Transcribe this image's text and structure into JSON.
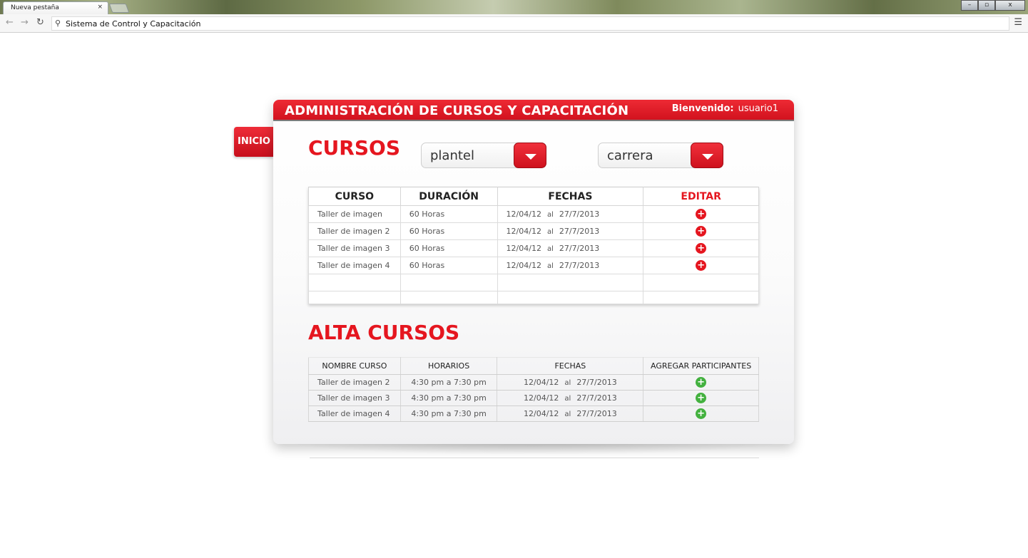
{
  "browser": {
    "tab_title": "Nueva pestaña",
    "tab_close": "×",
    "address": "Sistema de Control y Capacitación",
    "window_controls": [
      "–",
      "▫",
      "x"
    ]
  },
  "sidebar": {
    "inicio_label": "INICIO"
  },
  "header": {
    "title": "ADMINISTRACIÓN DE CURSOS Y CAPACITACIÓN",
    "welcome_label": "Bienvenido:",
    "username": "usuario1"
  },
  "cursos": {
    "title": "CURSOS",
    "filters": {
      "plantel": "plantel",
      "carrera": "carrera"
    },
    "columns": {
      "curso": "CURSO",
      "duracion": "DURACIÓN",
      "fechas": "FECHAS",
      "editar": "EDITAR"
    },
    "rows": [
      {
        "curso": "Taller de imagen",
        "duracion": "60 Horas",
        "desde": "12/04/12",
        "al": "al",
        "hasta": "27/7/2013"
      },
      {
        "curso": "Taller de imagen 2",
        "duracion": "60 Horas",
        "desde": "12/04/12",
        "al": "al",
        "hasta": "27/7/2013"
      },
      {
        "curso": "Taller de imagen 3",
        "duracion": "60 Horas",
        "desde": "12/04/12",
        "al": "al",
        "hasta": "27/7/2013"
      },
      {
        "curso": "Taller de imagen 4",
        "duracion": "60 Horas",
        "desde": "12/04/12",
        "al": "al",
        "hasta": "27/7/2013"
      }
    ]
  },
  "alta": {
    "title": "ALTA CURSOS",
    "columns": {
      "nombre": "NOMBRE CURSO",
      "horarios": "HORARIOS",
      "fechas": "FECHAS",
      "agregar": "AGREGAR PARTICIPANTES"
    },
    "rows": [
      {
        "nombre": "Taller de imagen 2",
        "horario": "4:30 pm a 7:30 pm",
        "desde": "12/04/12",
        "al": "al",
        "hasta": "27/7/2013"
      },
      {
        "nombre": "Taller de imagen 3",
        "horario": "4:30 pm a 7:30 pm",
        "desde": "12/04/12",
        "al": "al",
        "hasta": "27/7/2013"
      },
      {
        "nombre": "Taller de imagen 4",
        "horario": "4:30 pm a 7:30 pm",
        "desde": "12/04/12",
        "al": "al",
        "hasta": "27/7/2013"
      }
    ]
  },
  "colors": {
    "brand_red": "#e5161f",
    "add_green": "#43b13f"
  },
  "icons": {
    "edit": "plus-circle-red",
    "add": "plus-circle-green"
  }
}
